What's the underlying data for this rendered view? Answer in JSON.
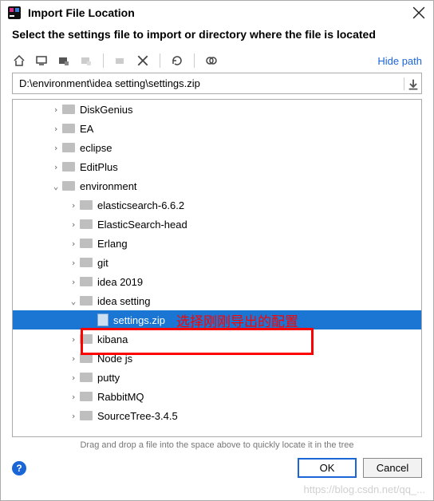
{
  "window": {
    "title": "Import File Location",
    "subtitle": "Select the settings file to import or directory where the file is located"
  },
  "toolbar": {
    "hide_path": "Hide path"
  },
  "path_input": {
    "value": "D:\\environment\\idea setting\\settings.zip"
  },
  "tree": {
    "items": [
      {
        "label": "DiskGenius",
        "depth": 2,
        "expanded": false,
        "type": "folder",
        "selected": false
      },
      {
        "label": "EA",
        "depth": 2,
        "expanded": false,
        "type": "folder",
        "selected": false
      },
      {
        "label": "eclipse",
        "depth": 2,
        "expanded": false,
        "type": "folder",
        "selected": false
      },
      {
        "label": "EditPlus",
        "depth": 2,
        "expanded": false,
        "type": "folder",
        "selected": false
      },
      {
        "label": "environment",
        "depth": 2,
        "expanded": true,
        "type": "folder",
        "selected": false
      },
      {
        "label": "elasticsearch-6.6.2",
        "depth": 3,
        "expanded": false,
        "type": "folder",
        "selected": false
      },
      {
        "label": "ElasticSearch-head",
        "depth": 3,
        "expanded": false,
        "type": "folder",
        "selected": false
      },
      {
        "label": "Erlang",
        "depth": 3,
        "expanded": false,
        "type": "folder",
        "selected": false
      },
      {
        "label": "git",
        "depth": 3,
        "expanded": false,
        "type": "folder",
        "selected": false
      },
      {
        "label": "idea 2019",
        "depth": 3,
        "expanded": false,
        "type": "folder",
        "selected": false
      },
      {
        "label": "idea setting",
        "depth": 3,
        "expanded": true,
        "type": "folder",
        "selected": false
      },
      {
        "label": "settings.zip",
        "depth": 4,
        "expanded": null,
        "type": "file",
        "selected": true
      },
      {
        "label": "kibana",
        "depth": 3,
        "expanded": false,
        "type": "folder",
        "selected": false
      },
      {
        "label": "Node js",
        "depth": 3,
        "expanded": false,
        "type": "folder",
        "selected": false
      },
      {
        "label": "putty",
        "depth": 3,
        "expanded": false,
        "type": "folder",
        "selected": false
      },
      {
        "label": "RabbitMQ",
        "depth": 3,
        "expanded": false,
        "type": "folder",
        "selected": false
      },
      {
        "label": "SourceTree-3.4.5",
        "depth": 3,
        "expanded": false,
        "type": "folder",
        "selected": false
      }
    ]
  },
  "hint": "Drag and drop a file into the space above to quickly locate it in the tree",
  "buttons": {
    "ok": "OK",
    "cancel": "Cancel"
  },
  "annotation": {
    "text": "选择刚刚导出的配置"
  },
  "watermark": "https://blog.csdn.net/qq_..."
}
